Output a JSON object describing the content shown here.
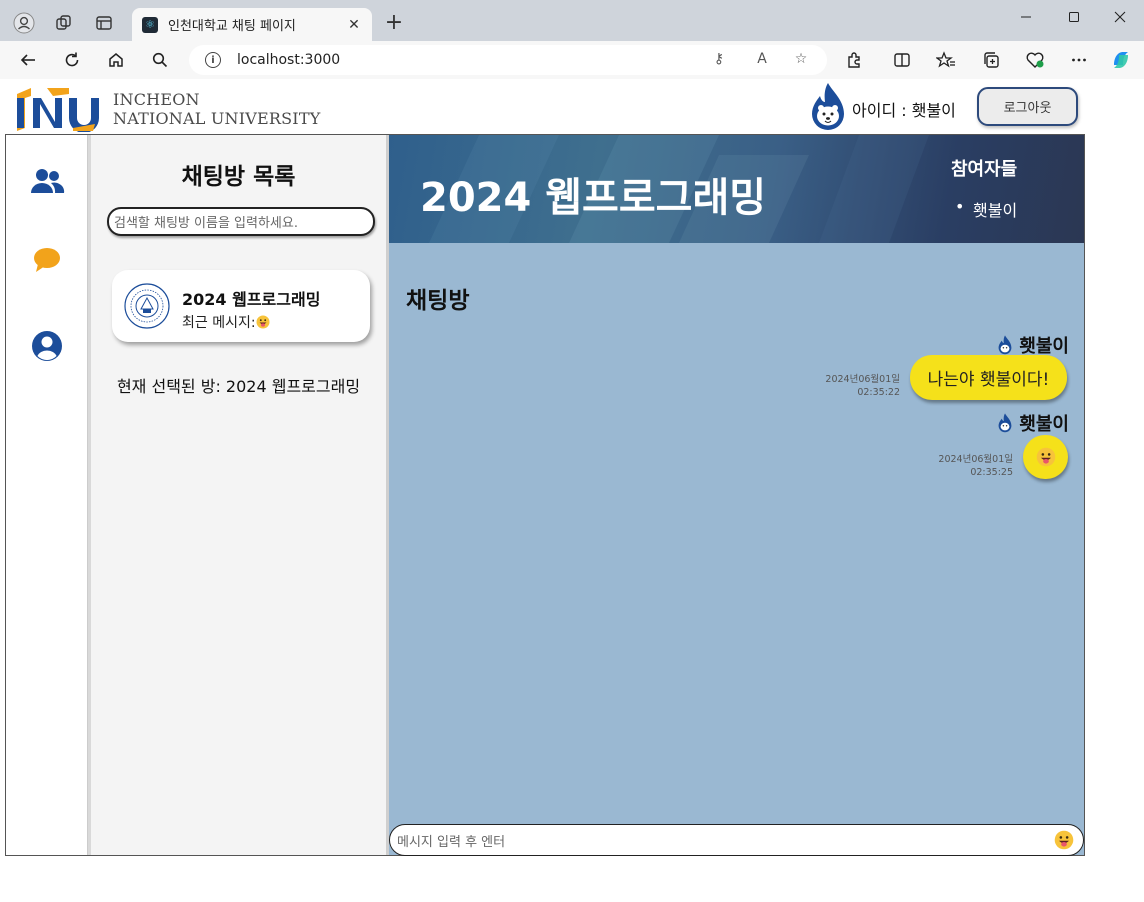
{
  "browser": {
    "tab_title": "인천대학교 채팅 페이지",
    "address": "localhost:3000"
  },
  "header": {
    "logo_line1": "INCHEON",
    "logo_line2": "NATIONAL UNIVERSITY",
    "user_label": "아이디 : 횃불이",
    "logout_label": "로그아웃"
  },
  "sidebar": {
    "items": [
      {
        "icon": "users-icon"
      },
      {
        "icon": "chat-bubble-icon"
      },
      {
        "icon": "profile-icon"
      }
    ]
  },
  "room_list": {
    "title": "채팅방 목록",
    "search_placeholder": "검색할 채팅방 이름을 입력하세요.",
    "rooms": [
      {
        "name": "2024 웹프로그래밍",
        "last_message_label": "최근 메시지:"
      }
    ],
    "selected_text": "현재 선택된 방: 2024 웹프로그래밍"
  },
  "chat": {
    "room_title": "2024 웹프로그래밍",
    "participants_title": "참여자들",
    "participants": [
      "횃불이"
    ],
    "heading": "채팅방",
    "messages": [
      {
        "sender": "횃불이",
        "text": "나는야 횃불이다!",
        "date": "2024년06월01일",
        "time": "02:35:22"
      },
      {
        "sender": "횃불이",
        "emoji": "grinning-tongue-emoji",
        "date": "2024년06월01일",
        "time": "02:35:25"
      }
    ],
    "input_placeholder": "메시지 입력 후 엔터"
  },
  "colors": {
    "brand_blue": "#2d4a7c",
    "chat_background": "#9ab8d2",
    "bubble_yellow": "#f5e11a",
    "logo_orange": "#f2a31b"
  }
}
